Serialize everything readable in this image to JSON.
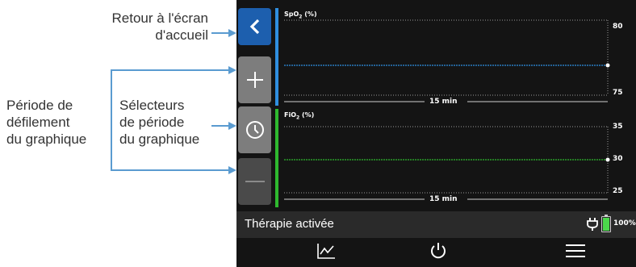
{
  "callouts": {
    "home": "Retour à l'écran d'accueil",
    "home_line1": "Retour à l'écran",
    "home_line2": "d'accueil",
    "scroll_line1": "Période de",
    "scroll_line2": "défilement",
    "scroll_line3": "du graphique",
    "selectors_line1": "Sélecteurs",
    "selectors_line2": "de période",
    "selectors_line3": "du graphique"
  },
  "sidebar": {
    "back_icon": "chevron-left-icon",
    "zoom_in_icon": "plus-icon",
    "period_icon": "clock-icon",
    "zoom_out_icon": "minus-icon"
  },
  "graphs": [
    {
      "label": "SpO",
      "label_sub": "2",
      "label_suffix": " (%)",
      "color": "#2f8fe0",
      "y_ticks": [
        "80",
        "75"
      ],
      "period": "15 min"
    },
    {
      "label": "FiO",
      "label_sub": "2",
      "label_suffix": " (%)",
      "color": "#2eb82e",
      "y_ticks": [
        "35",
        "30",
        "25"
      ],
      "period": "15 min"
    }
  ],
  "status": {
    "therapy": "Thérapie activée",
    "battery": "100%",
    "battery_color": "#4bd84b"
  },
  "nav": {
    "trend_icon": "trend-chart-icon",
    "power_icon": "power-icon",
    "menu_icon": "menu-icon"
  }
}
